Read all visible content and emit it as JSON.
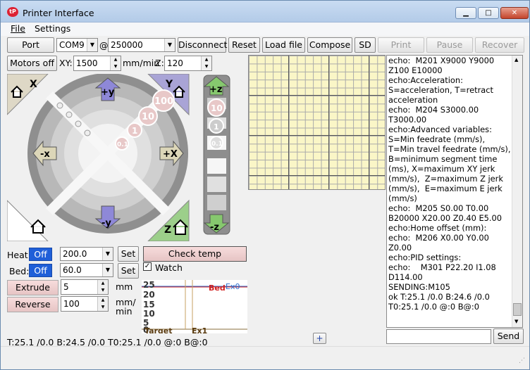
{
  "window": {
    "title": "Printer Interface",
    "minimize_glyph": "▁",
    "maximize_glyph": "□",
    "close_glyph": "✕",
    "app_icon_label": "tP"
  },
  "menu": [
    "File",
    "Settings"
  ],
  "toolbar": {
    "port_label": "Port",
    "port_value": "COM9",
    "at_sign": "@",
    "baud_value": "250000",
    "disconnect_label": "Disconnect",
    "reset_label": "Reset",
    "load_file_label": "Load file",
    "compose_label": "Compose",
    "sd_label": "SD",
    "print_label": "Print",
    "pause_label": "Pause",
    "recover_label": "Recover"
  },
  "motion": {
    "motors_off_label": "Motors off",
    "xy_label": "XY:",
    "xy_feed": "1500",
    "unit_label": "mm/min",
    "z_label": "Z:",
    "z_feed": "120"
  },
  "jog": {
    "home_x": "X",
    "home_y": "Y",
    "home_z": "Z",
    "plus_y": "+y",
    "minus_y": "-y",
    "plus_x": "+X",
    "minus_x": "-x",
    "plus_z": "+z",
    "minus_z": "-z",
    "steps_xy": [
      "100",
      "10",
      "1",
      "0.1"
    ],
    "steps_z": [
      "10",
      "1",
      "0.1"
    ]
  },
  "temps": {
    "heat_label": "Heat:",
    "heat_toggle": "Off",
    "heat_value": "200.0",
    "bed_label": "Bed:",
    "bed_toggle": "Off",
    "bed_value": "60.0",
    "set_label": "Set",
    "check_temp_label": "Check temp",
    "watch_label": "Watch",
    "watch_checked": true,
    "extrude_label": "Extrude",
    "extrude_value": "5",
    "extrude_unit": "mm",
    "reverse_label": "Reverse",
    "reverse_value": "100",
    "reverse_unit_1": "mm/",
    "reverse_unit_2": "min"
  },
  "graph": {
    "yticks": [
      "25",
      "20",
      "15",
      "10",
      "5",
      "0"
    ],
    "bed_label": "Bed",
    "ex0_label": "Ex0",
    "target_label": "Target",
    "ex1_label": "Ex1",
    "bed_color": "#d22020",
    "ex0_color": "#2f6fd0",
    "plus_button": "+"
  },
  "console": {
    "lines": [
      "echo:  M201 X9000 Y9000 Z100 E10000",
      "echo:Acceleration: S=acceleration, T=retract acceleration",
      "echo:  M204 S3000.00 T3000.00",
      "echo:Advanced variables: S=Min feedrate (mm/s), T=Min travel feedrate (mm/s), B=minimum segment time (ms), X=maximum XY jerk (mm/s),  Z=maximum Z jerk (mm/s),  E=maximum E jerk (mm/s)",
      "echo:  M205 S0.00 T0.00 B20000 X20.00 Z0.40 E5.00",
      "echo:Home offset (mm):",
      "echo:  M206 X0.00 Y0.00 Z0.00",
      "echo:PID settings:",
      "echo:    M301 P22.20 I1.08 D114.00",
      "SENDING:M105",
      "ok T:25.1 /0.0 B:24.6 /0.0 T0:25.1 /0.0 @:0 B@:0"
    ],
    "send_label": "Send"
  },
  "status": {
    "text": "T:25.1 /0.0 B:24.5 /0.0 T0:25.1 /0.0 @:0 B@:0"
  }
}
